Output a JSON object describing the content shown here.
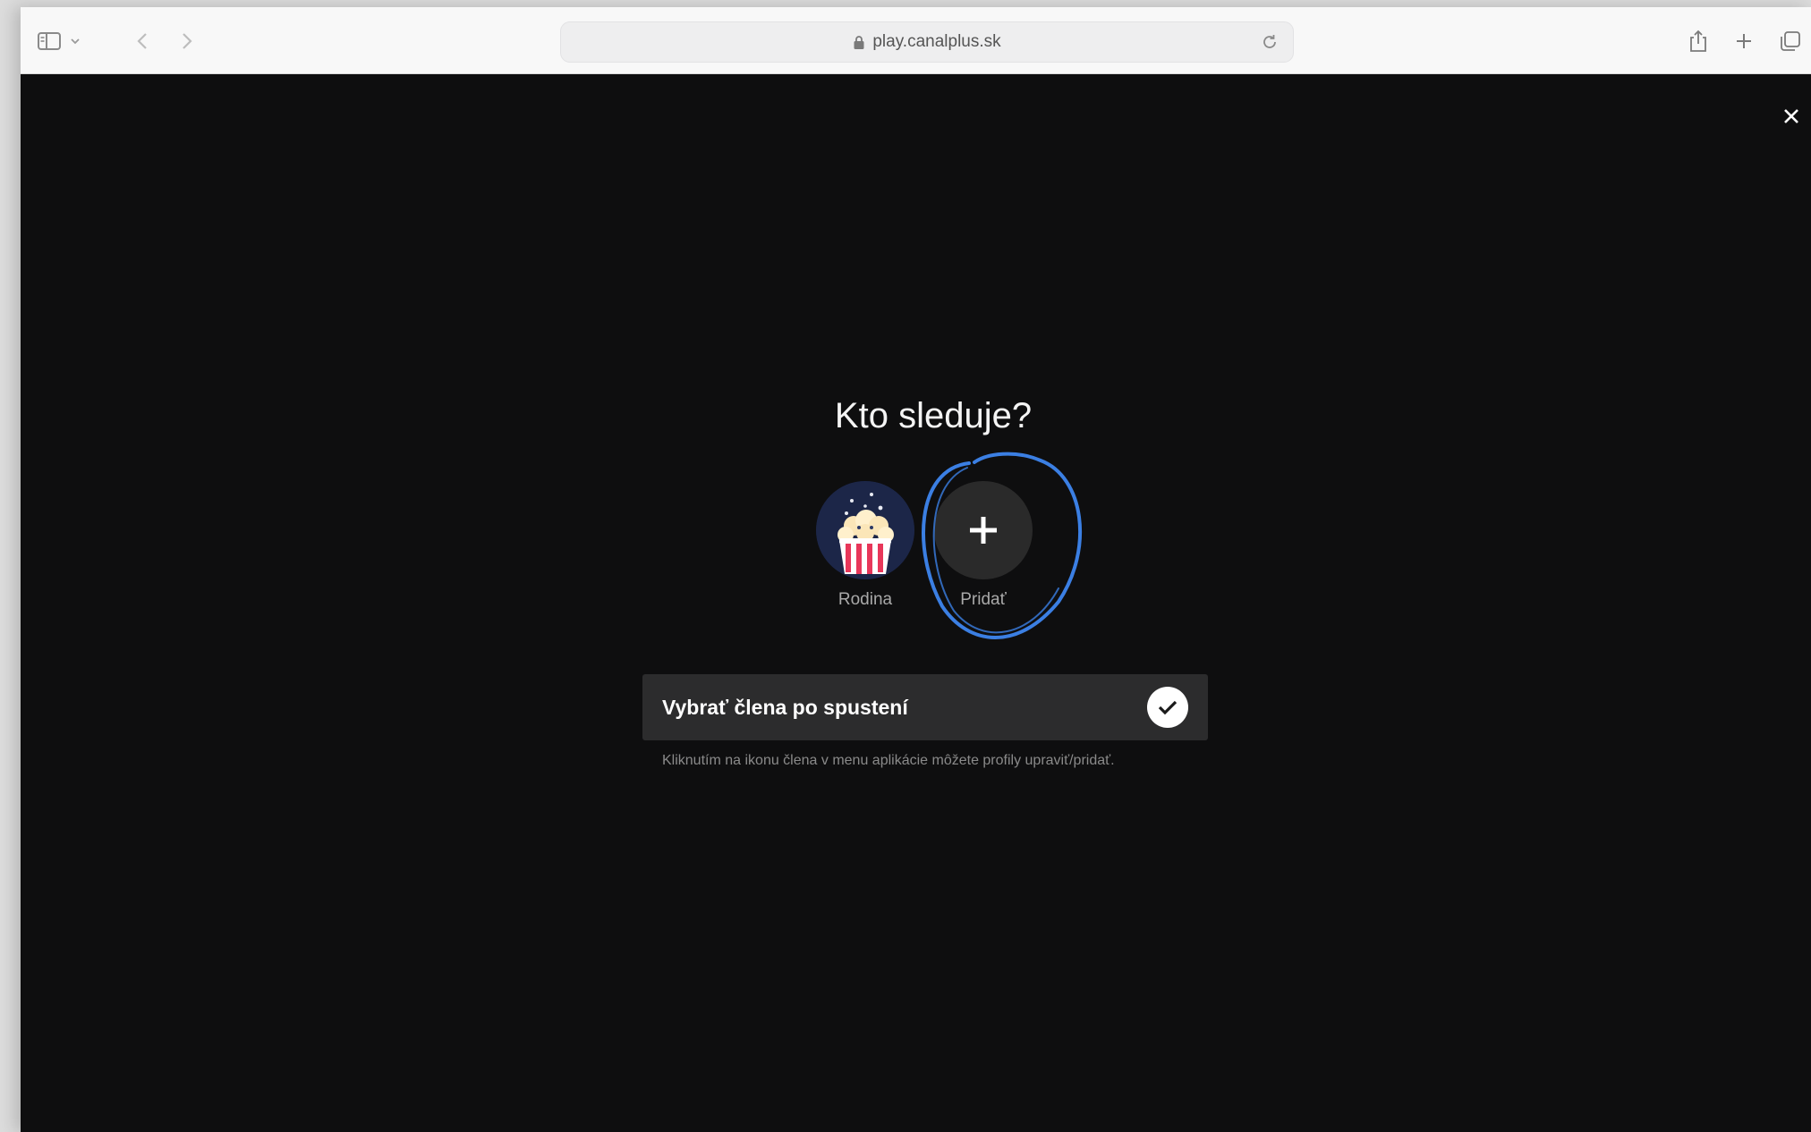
{
  "browser": {
    "url": "play.canalplus.sk"
  },
  "page": {
    "title": "Kto sleduje?",
    "profiles": [
      {
        "label": "Rodina",
        "icon": "popcorn-avatar-icon"
      },
      {
        "label": "Pridať",
        "icon": "plus-icon"
      }
    ],
    "toggle": {
      "label": "Vybrať člena po spustení",
      "checked": true
    },
    "hint": "Kliknutím na ikonu člena v menu aplikácie môžete profily upraviť/pridať."
  },
  "colors": {
    "background": "#0e0e0f",
    "annotation": "#3b7fe3",
    "avatar_bg": "#1c2648",
    "stripe": "#e8375a"
  }
}
